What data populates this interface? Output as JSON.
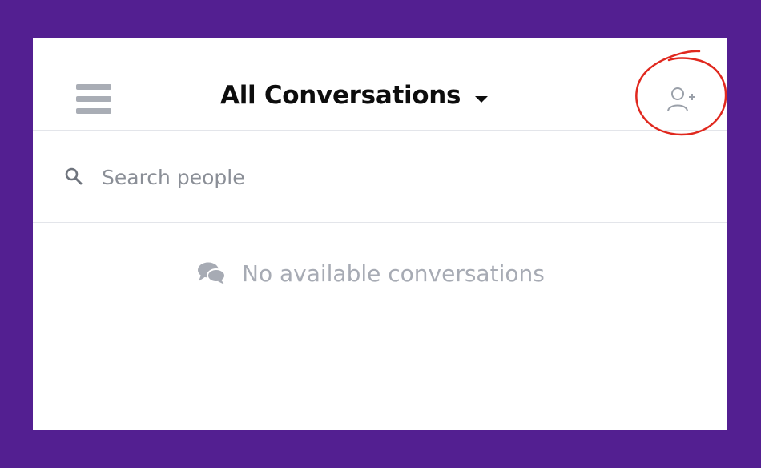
{
  "header": {
    "title": "All Conversations",
    "menu_icon": "hamburger-menu-icon",
    "dropdown_icon": "caret-down-icon",
    "add_user_icon": "add-person-icon"
  },
  "search": {
    "placeholder": "Search people",
    "value": "",
    "icon": "search-icon"
  },
  "conversations": {
    "empty_message": "No available conversations",
    "empty_icon": "chat-bubbles-icon"
  },
  "colors": {
    "frame_background": "#531f91",
    "panel_background": "#ffffff",
    "highlight_circle": "#e0281e",
    "muted_text": "#a7abb4"
  }
}
